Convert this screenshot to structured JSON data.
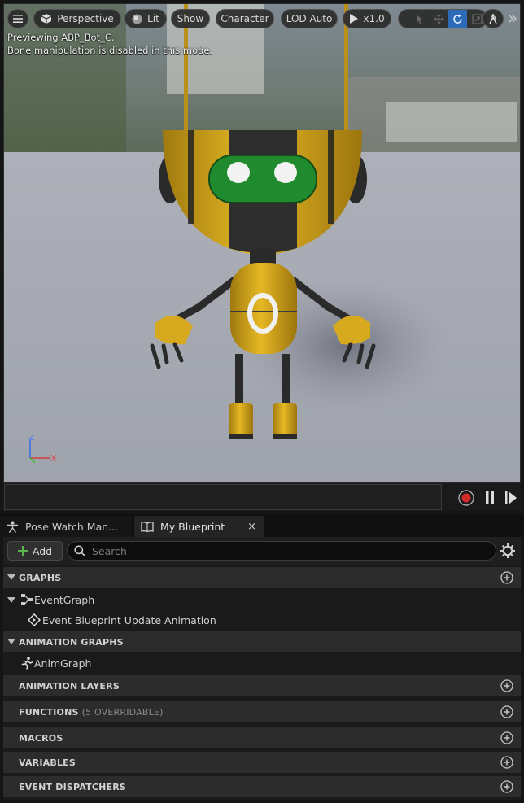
{
  "viewport_toolbar": {
    "perspective_label": "Perspective",
    "lit_label": "Lit",
    "show_label": "Show",
    "character_label": "Character",
    "lod_label": "LOD Auto",
    "play_speed_label": "x1.0"
  },
  "viewport": {
    "preview_message": "Previewing ABP_Bot_C.",
    "bone_message": "Bone manipulation is disabled in this mode.",
    "axis_z": "Z",
    "axis_x": "X"
  },
  "tabs": [
    {
      "label": "Pose Watch Man..."
    },
    {
      "label": "My Blueprint",
      "close": "×"
    }
  ],
  "toolbar": {
    "add_label": "Add",
    "search_placeholder": "Search"
  },
  "sections": {
    "graphs": "GRAPHS",
    "animation_graphs": "ANIMATION GRAPHS",
    "animation_layers": "ANIMATION LAYERS",
    "functions": "FUNCTIONS",
    "functions_sub": "(5 OVERRIDABLE)",
    "macros": "MACROS",
    "variables": "VARIABLES",
    "event_dispatchers": "EVENT DISPATCHERS"
  },
  "items": {
    "event_graph": "EventGraph",
    "event_update": "Event Blueprint Update Animation",
    "anim_graph": "AnimGraph"
  },
  "colors": {
    "accent_blue": "#2d6bb8",
    "robot_yellow": "#e2b420",
    "face_green": "#1f8a2e",
    "record_red": "#d42a2a"
  }
}
